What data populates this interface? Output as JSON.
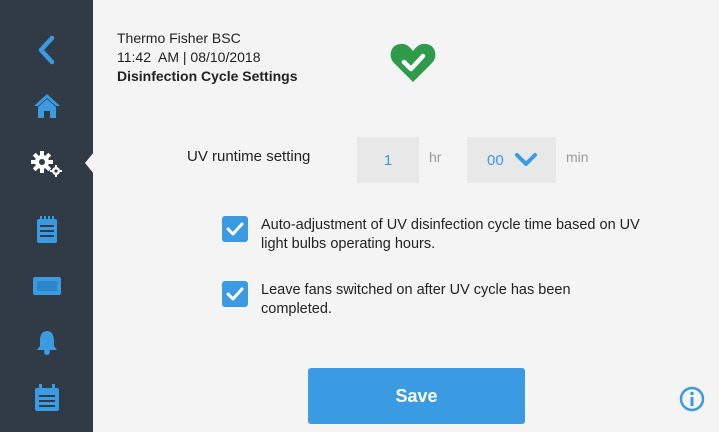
{
  "header": {
    "device_name": "Thermo Fisher BSC",
    "datetime": "11:42  AM | 08/10/2018",
    "title": "Disinfection Cycle Settings"
  },
  "colors": {
    "accent": "#3a9be3",
    "sidebar": "#303b46",
    "status_ok": "#2e9b4a"
  },
  "sidebar": {
    "items": [
      {
        "icon": "back-arrow-icon"
      },
      {
        "icon": "home-icon"
      },
      {
        "icon": "settings-gears-icon",
        "active": true
      },
      {
        "icon": "clipboard-icon"
      },
      {
        "icon": "monitor-icon"
      },
      {
        "icon": "bell-icon"
      },
      {
        "icon": "calendar-icon"
      }
    ]
  },
  "status": {
    "icon": "heart-check-icon"
  },
  "runtime": {
    "label": "UV runtime setting",
    "hours_value": "1",
    "hours_unit": "hr",
    "minutes_value": "00",
    "minutes_unit": "min"
  },
  "options": [
    {
      "checked": true,
      "label": "Auto-adjustment of UV disinfection cycle time based on UV light bulbs operating hours."
    },
    {
      "checked": true,
      "label": "Leave fans switched on after UV cycle has been completed."
    }
  ],
  "actions": {
    "save_label": "Save",
    "info_icon": "info-icon"
  }
}
